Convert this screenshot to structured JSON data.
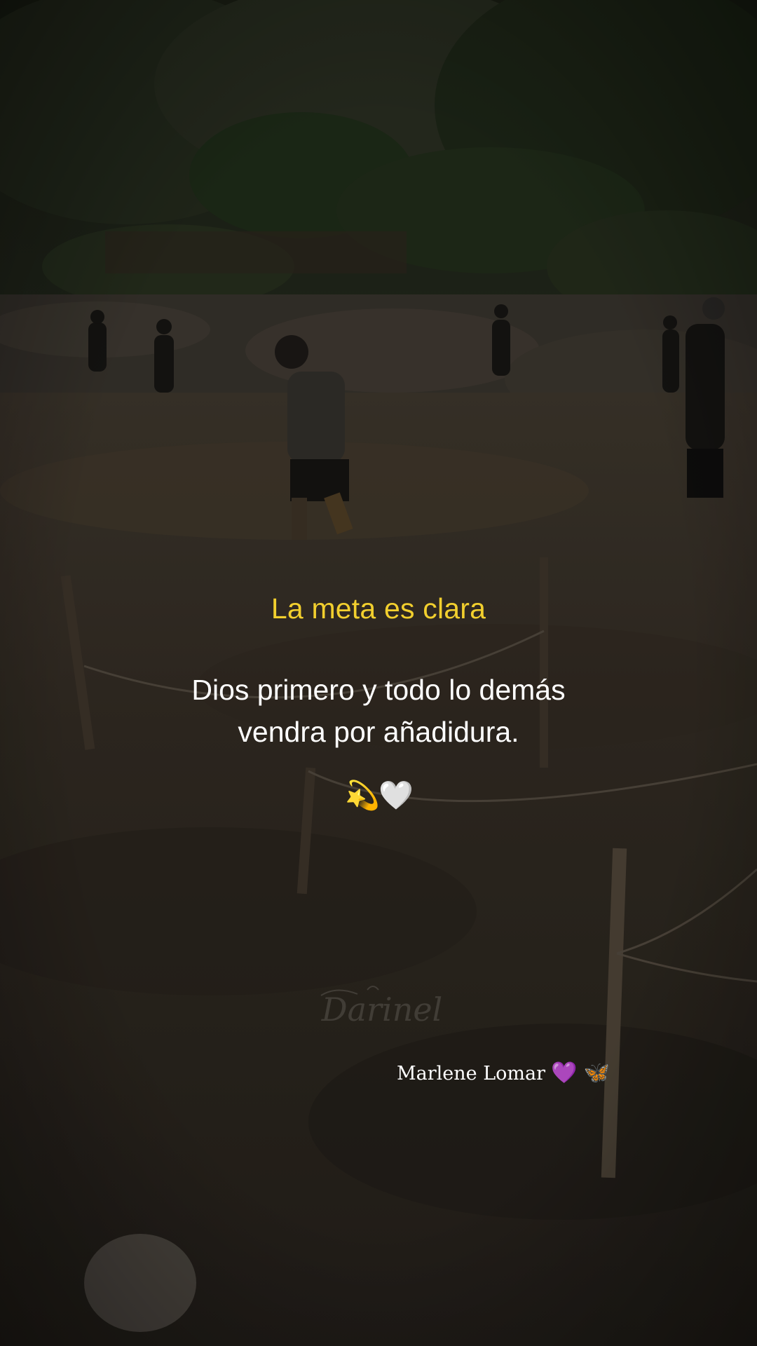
{
  "caption": {
    "title": "La meta es clara",
    "body_line1": "Dios primero y todo lo demás",
    "body_line2": "vendra por añadidura.",
    "emoji": "💫🤍"
  },
  "signature": {
    "name": "Marlene Lomar",
    "emoji": "💜 🦋"
  },
  "watermark": {
    "text": "Darinel"
  },
  "colors": {
    "title": "#f2cf2e",
    "body": "#ffffff",
    "signature": "#ffffff"
  },
  "scene_icons": [
    "hillside",
    "river-crossing",
    "wooden-posts",
    "rope",
    "people-walking",
    "rocks"
  ]
}
